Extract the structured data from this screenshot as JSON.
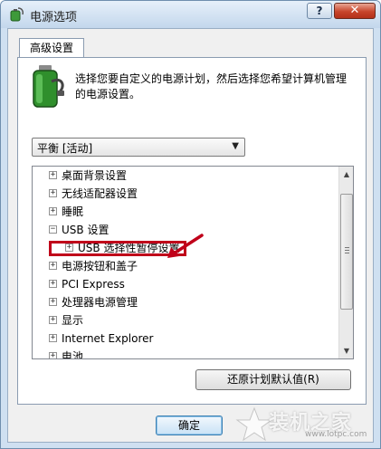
{
  "window": {
    "title": "电源选项",
    "help_label": "?",
    "close_label": "✕"
  },
  "tab": {
    "label": "高级设置"
  },
  "description": "选择您要自定义的电源计划，然后选择您希望计算机管理的电源设置。",
  "plan_dropdown": {
    "selected": "平衡 [活动]",
    "arrow": "▼"
  },
  "tree": {
    "items": [
      {
        "expander": "+",
        "label": "桌面背景设置"
      },
      {
        "expander": "+",
        "label": "无线适配器设置"
      },
      {
        "expander": "+",
        "label": "睡眠"
      },
      {
        "expander": "−",
        "label": "USB 设置"
      },
      {
        "expander": "+",
        "label": "USB 选择性暂停设置"
      },
      {
        "expander": "+",
        "label": "电源按钮和盖子"
      },
      {
        "expander": "+",
        "label": "PCI Express"
      },
      {
        "expander": "+",
        "label": "处理器电源管理"
      },
      {
        "expander": "+",
        "label": "显示"
      },
      {
        "expander": "+",
        "label": "Internet Explorer"
      },
      {
        "expander": "+",
        "label": "电池"
      }
    ],
    "scroll_up": "▲",
    "scroll_down": "▼"
  },
  "buttons": {
    "restore_label": "还原计划默认值(R)",
    "ok_label": "确定"
  },
  "watermark": {
    "brand": "装机之家",
    "url": "www.lotpc.com"
  },
  "colors": {
    "highlight": "#c0001a",
    "titlebar": "#c3d7ec"
  }
}
